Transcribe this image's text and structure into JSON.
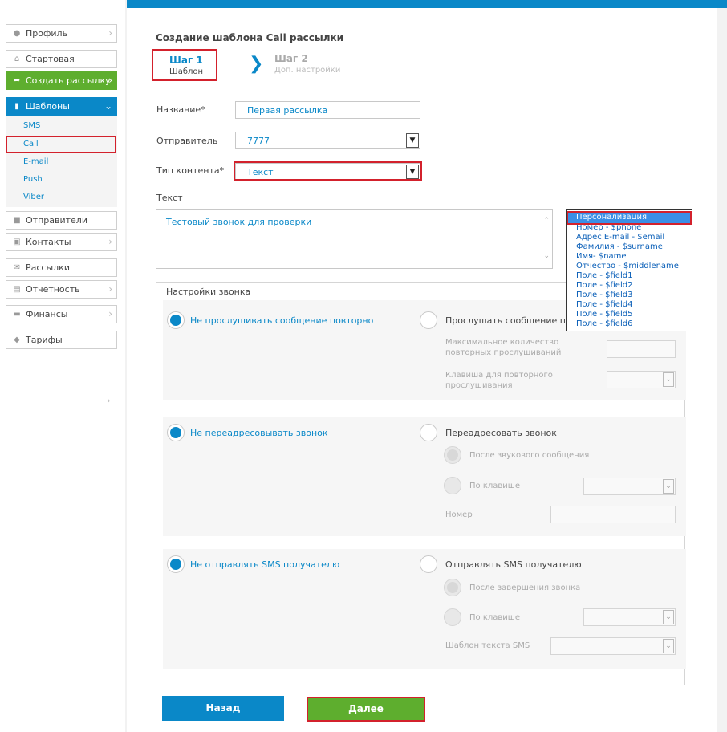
{
  "sidebar": {
    "profile": "Профиль",
    "start": "Стартовая",
    "create": "Создать рассылку",
    "templates": "Шаблоны",
    "sub": [
      "SMS",
      "Call",
      "E-mail",
      "Push",
      "Viber"
    ],
    "senders": "Отправители",
    "contacts": "Контакты",
    "mailings": "Рассылки",
    "reports": "Отчетность",
    "finance": "Финансы",
    "tariffs": "Тарифы"
  },
  "page": {
    "title": "Создание шаблона Call рассылки",
    "step1_title": "Шаг 1",
    "step1_sub": "Шаблон",
    "step2_title": "Шаг 2",
    "step2_sub": "Доп. настройки"
  },
  "form": {
    "name_label": "Название*",
    "name_value": "Первая рассылка",
    "sender_label": "Отправитель",
    "sender_value": "7777",
    "content_label": "Тип контента*",
    "content_value": "Текст",
    "text_label": "Текст",
    "text_value": "Тестовый звонок для проверки"
  },
  "personalization": {
    "items": [
      "Персонализация",
      "Номер - $phone",
      "Адрес E-mail - $email",
      "Фамилия - $surname",
      "Имя- $name",
      "Отчество - $middlename",
      "Поле - $field1",
      "Поле - $field2",
      "Поле - $field3",
      "Поле - $field4",
      "Поле - $field5",
      "Поле - $field6"
    ]
  },
  "settings": {
    "title": "Настройки звонка",
    "no_replay": "Не прослушивать сообщение повторно",
    "replay": "Прослушать сообщение повто",
    "max_replays": "Максимальное количество повторных прослушиваний",
    "replay_key": "Клавиша для повторного прослушивания",
    "no_redirect": "Не переадресовывать звонок",
    "redirect": "Переадресовать звонок",
    "after_voice": "После звукового сообщения",
    "by_key": "По клавише",
    "number": "Номер",
    "no_sms": "Не отправлять SMS получателю",
    "send_sms": "Отправлять SMS получателю",
    "after_call": "После завершения звонка",
    "by_key2": "По клавише",
    "sms_template": "Шаблон текста SMS"
  },
  "buttons": {
    "back": "Назад",
    "next": "Далее"
  }
}
